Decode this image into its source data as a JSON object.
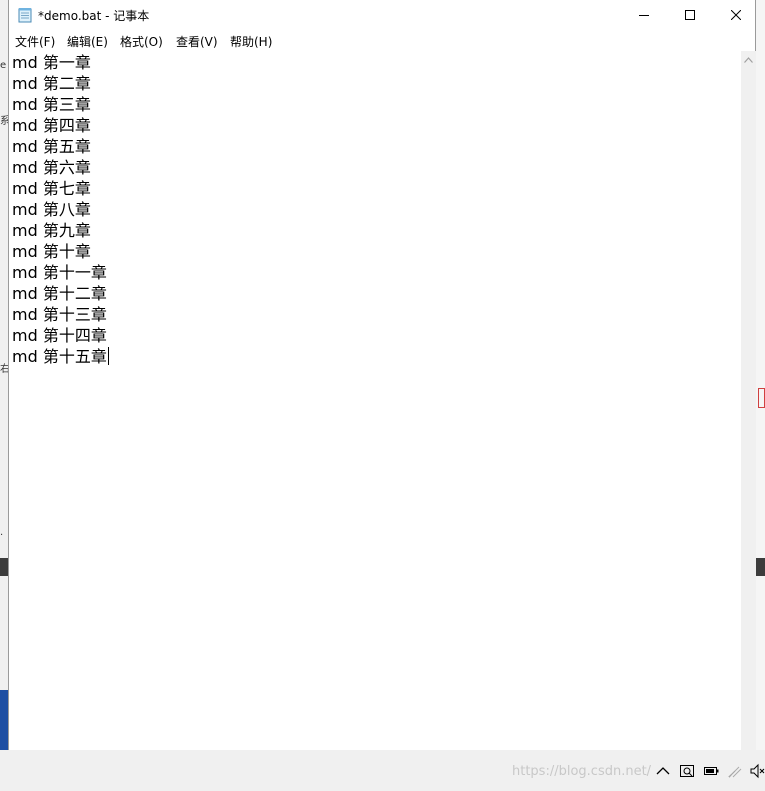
{
  "window": {
    "title": "*demo.bat - 记事本",
    "app_icon": "notepad-icon",
    "controls": [
      "minimize-icon",
      "maximize-icon",
      "close-icon"
    ]
  },
  "menu": {
    "items": [
      "文件(F)",
      "编辑(E)",
      "格式(O)",
      "查看(V)",
      "帮助(H)"
    ]
  },
  "editor": {
    "lines": [
      "md 第一章",
      "md 第二章",
      "md 第三章",
      "md 第四章",
      "md 第五章",
      "md 第六章",
      "md 第七章",
      "md 第八章",
      "md 第九章",
      "md 第十章",
      "md 第十一章",
      "md 第十二章",
      "md 第十三章",
      "md 第十四章",
      "md 第十五章"
    ]
  },
  "taskbar": {
    "tray_icons": [
      "chevron-up-icon",
      "tray-app-icon",
      "battery-icon",
      "network-icon",
      "volume-icon"
    ]
  },
  "watermark": "https://blog.csdn.net/"
}
